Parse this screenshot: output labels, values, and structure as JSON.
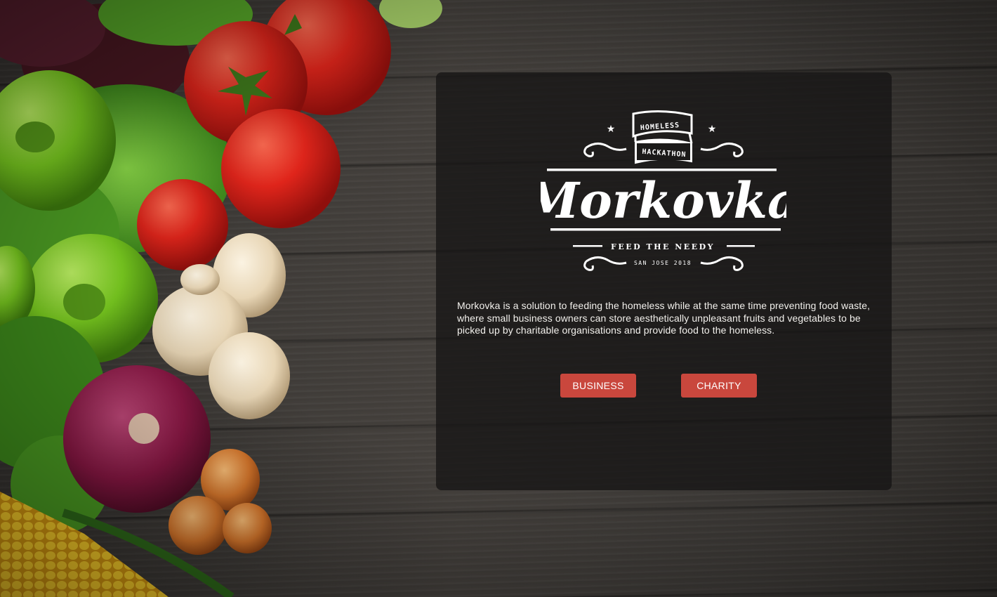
{
  "logo": {
    "banner_top": "HOMELESS",
    "banner_bottom": "HACKATHON",
    "title": "Morkovka",
    "tagline": "FEED THE NEEDY",
    "place": "SAN JOSE 2018"
  },
  "description": "Morkovka is a solution to feeding the homeless while at the same time preventing food waste, where small business owners can store aesthetically unpleasant fruits and vegetables to be picked up by charitable organisations and provide food to the homeless.",
  "buttons": {
    "business": "BUSINESS",
    "charity": "CHARITY"
  },
  "colors": {
    "button": "#c9473d",
    "background": "#3f3b38",
    "panel": "#161514"
  }
}
